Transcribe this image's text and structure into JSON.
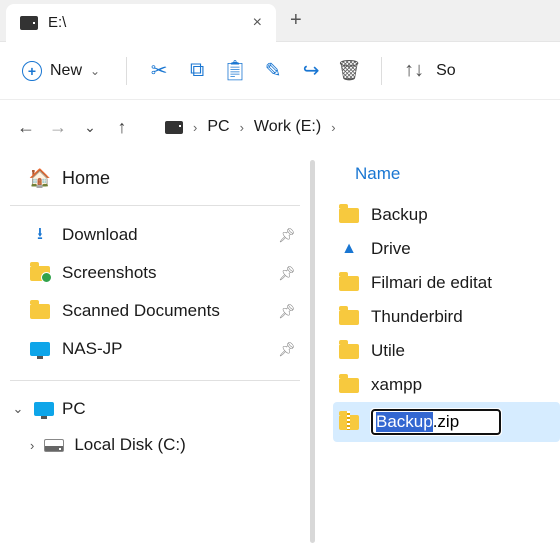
{
  "tab": {
    "title": "E:\\"
  },
  "toolbar": {
    "new_label": "New",
    "sort_label": "So"
  },
  "breadcrumb": {
    "pc": "PC",
    "drive": "Work (E:)"
  },
  "sidebar": {
    "home": "Home",
    "quick": [
      {
        "label": "Download",
        "icon": "download"
      },
      {
        "label": "Screenshots",
        "icon": "folder-badge"
      },
      {
        "label": "Scanned Documents",
        "icon": "folder"
      },
      {
        "label": "NAS-JP",
        "icon": "monitor"
      }
    ],
    "pc": "PC",
    "local_disk": "Local Disk (C:)"
  },
  "content": {
    "column_header": "Name",
    "items": [
      {
        "label": "Backup",
        "icon": "folder"
      },
      {
        "label": "Drive",
        "icon": "cloud"
      },
      {
        "label": "Filmari de editat",
        "icon": "folder"
      },
      {
        "label": "Thunderbird",
        "icon": "folder"
      },
      {
        "label": "Utile",
        "icon": "folder"
      },
      {
        "label": "xampp",
        "icon": "folder"
      }
    ],
    "rename": {
      "selected": "Backup",
      "rest": ".zip",
      "full": "Backup.zip"
    }
  }
}
